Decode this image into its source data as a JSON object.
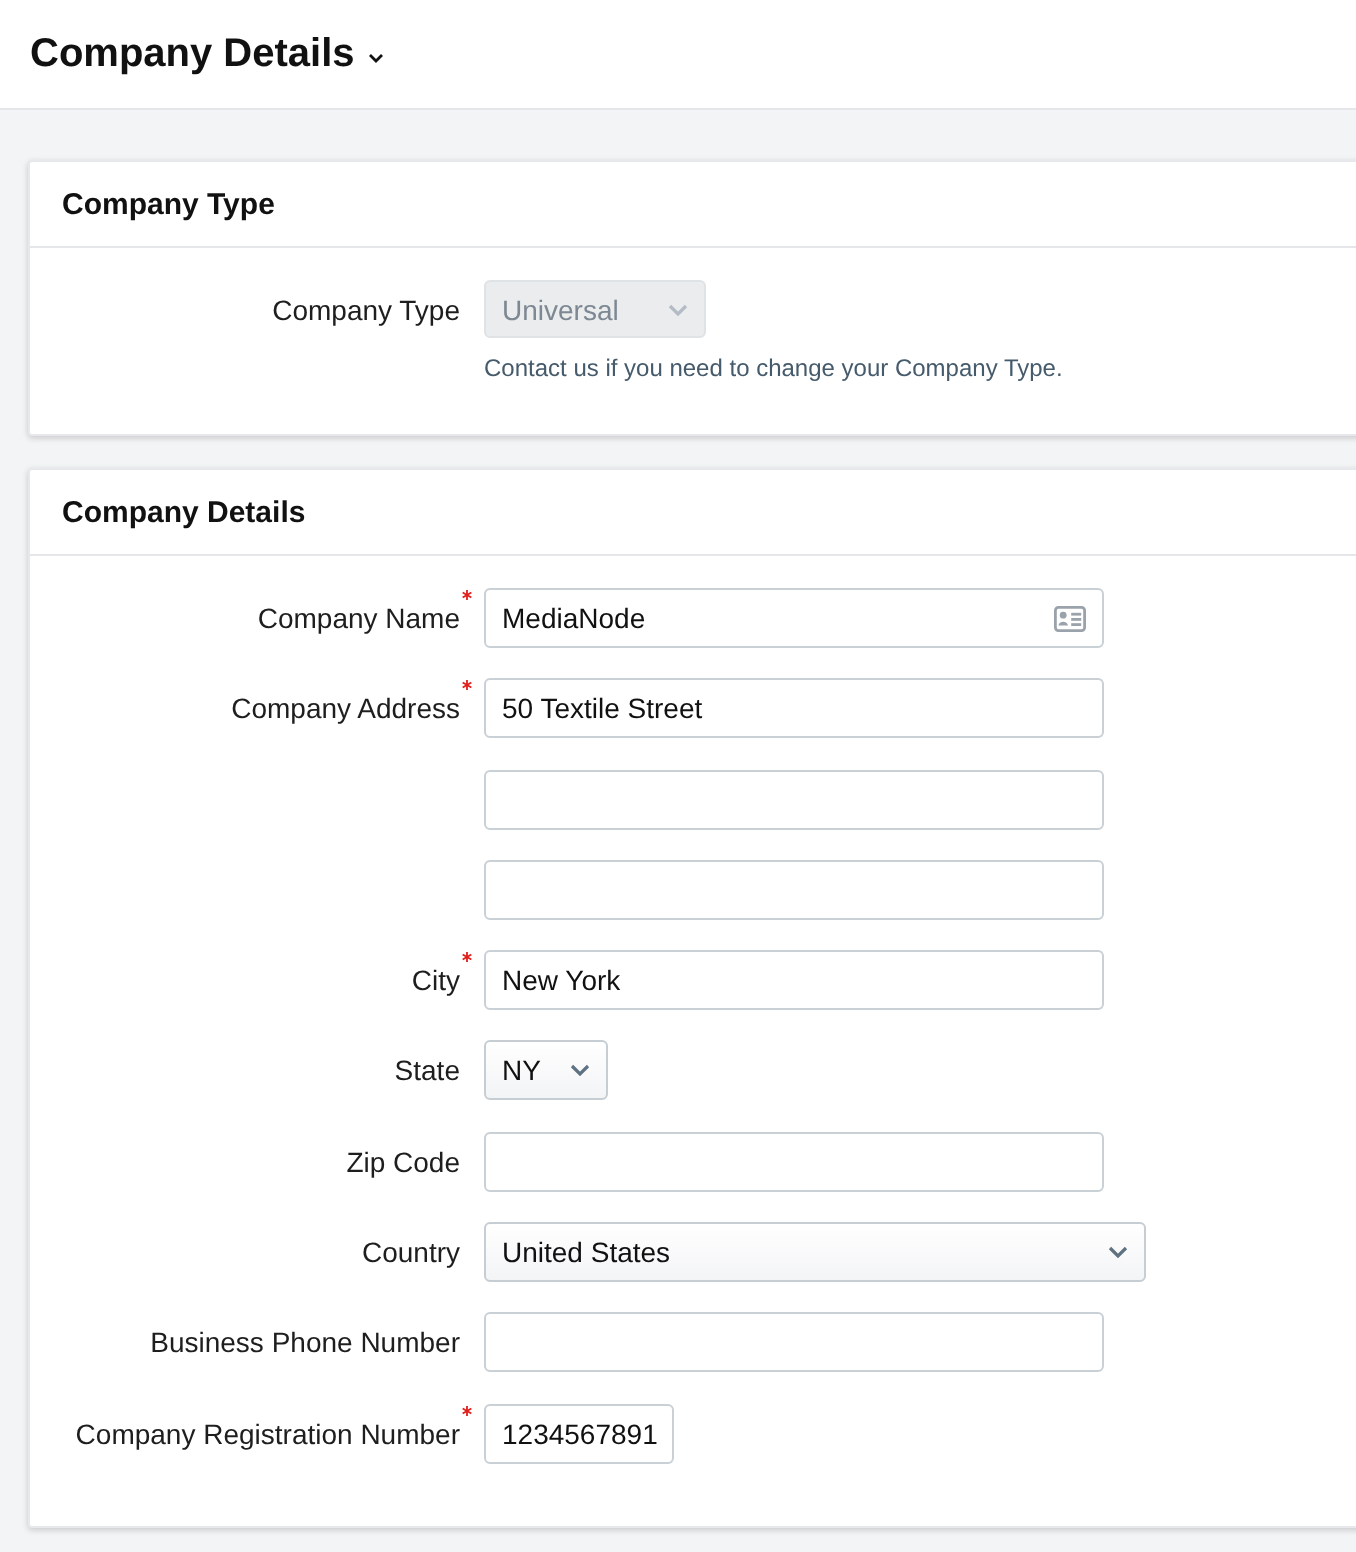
{
  "page": {
    "title": "Company Details"
  },
  "sections": [
    {
      "title": "Company Type",
      "fields": [
        {
          "label": "Company Type",
          "kind": "select",
          "value": "Universal",
          "required": false,
          "disabled": true,
          "hint": "Contact us if you need to change your Company Type."
        }
      ]
    },
    {
      "title": "Company Details",
      "fields": [
        {
          "label": "Company Name",
          "kind": "contact-text",
          "value": "MediaNode",
          "required": true,
          "disabled": false
        },
        {
          "label": "Company Address",
          "kind": "text",
          "value": "50 Textile Street",
          "required": true,
          "disabled": false
        },
        {
          "kind": "text",
          "required": false,
          "disabled": false
        },
        {
          "kind": "text",
          "required": false,
          "disabled": false
        },
        {
          "label": "City",
          "kind": "text",
          "value": "New York",
          "required": true,
          "disabled": false
        },
        {
          "label": "State",
          "kind": "select",
          "value": "NY",
          "required": false,
          "disabled": false
        },
        {
          "label": "Zip Code",
          "kind": "text",
          "required": false,
          "disabled": false
        },
        {
          "label": "Country",
          "kind": "select",
          "value": "United States",
          "required": false,
          "disabled": false
        },
        {
          "label": "Business Phone Number",
          "kind": "text",
          "required": false,
          "disabled": false
        },
        {
          "label": "Company Registration Number",
          "kind": "text",
          "value": "1234567891",
          "required": true,
          "disabled": false
        }
      ]
    }
  ]
}
